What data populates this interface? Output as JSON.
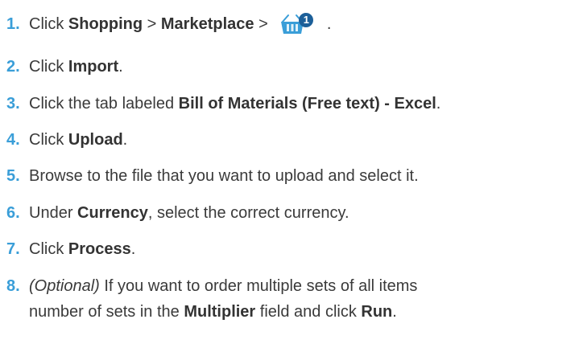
{
  "steps": [
    {
      "num": "1.",
      "parts": {
        "a": "Click ",
        "b": "Shopping",
        "c": " > ",
        "d": "Marketplace",
        "e": " > ",
        "f": " ."
      },
      "icon": {
        "name": "cart-icon",
        "badge": "1",
        "color": "#3a9ed8",
        "badge_color": "#1c5f99"
      }
    },
    {
      "num": "2.",
      "parts": {
        "a": "Click ",
        "b": "Import",
        "c": "."
      }
    },
    {
      "num": "3.",
      "parts": {
        "a": "Click the tab labeled ",
        "b": "Bill of Materials (Free text) - Excel",
        "c": "."
      }
    },
    {
      "num": "4.",
      "parts": {
        "a": "Click ",
        "b": "Upload",
        "c": "."
      }
    },
    {
      "num": "5.",
      "parts": {
        "a": "Browse to the file that you want to upload and select it."
      }
    },
    {
      "num": "6.",
      "parts": {
        "a": "Under ",
        "b": "Currency",
        "c": ", select the correct currency."
      }
    },
    {
      "num": "7.",
      "parts": {
        "a": "Click ",
        "b": "Process",
        "c": "."
      }
    },
    {
      "num": "8.",
      "parts": {
        "a": "(Optional)",
        "b": " If you want to order multiple sets of all items",
        "c": "number of sets in the ",
        "d": "Multiplier",
        "e": " field and click ",
        "f": "Run",
        "g": "."
      }
    }
  ],
  "colors": {
    "number": "#3a9ed8",
    "text": "#3a3a3a"
  }
}
